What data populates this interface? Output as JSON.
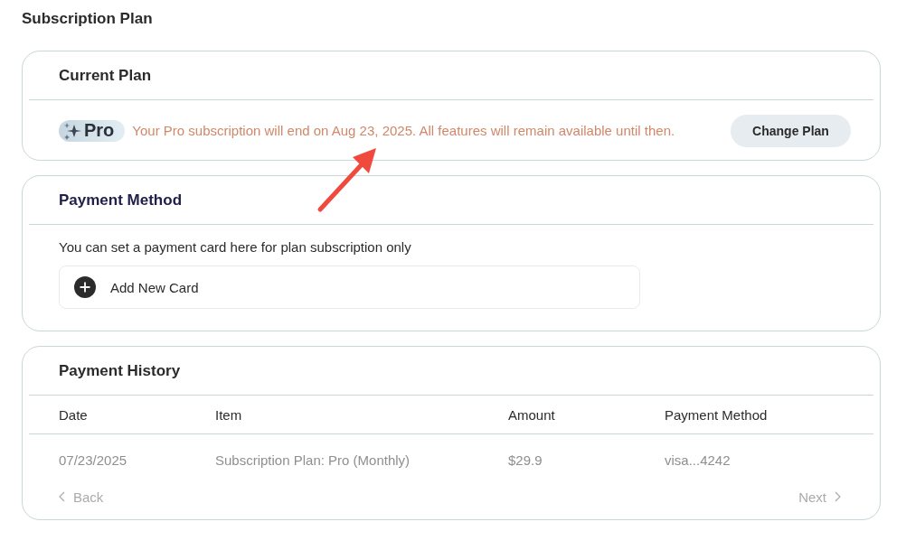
{
  "page_title": "Subscription Plan",
  "current_plan": {
    "title": "Current Plan",
    "badge": "Pro",
    "notice": "Your Pro subscription will end on Aug 23, 2025. All features will remain available until then.",
    "button": "Change Plan"
  },
  "payment_method": {
    "title": "Payment Method",
    "description": "You can set a payment card here for plan subscription only",
    "add_card": "Add New Card"
  },
  "payment_history": {
    "title": "Payment History",
    "columns": [
      "Date",
      "Item",
      "Amount",
      "Payment Method"
    ],
    "rows": [
      [
        "07/23/2025",
        "Subscription Plan: Pro (Monthly)",
        "$29.9",
        "visa...4242"
      ]
    ],
    "back": {
      "label": "Back",
      "disabled": true
    },
    "next": {
      "label": "Next",
      "disabled": true
    }
  },
  "annotation": {
    "kind": "arrow"
  }
}
